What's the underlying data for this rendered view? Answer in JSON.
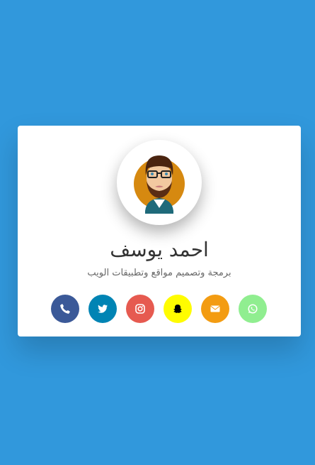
{
  "profile": {
    "name": "احمد يوسف",
    "title": "برمجة وتصميم مواقع وتطبيقات الويب"
  },
  "socials": [
    {
      "name": "phone",
      "color": "#3b5998"
    },
    {
      "name": "twitter",
      "color": "#0084b4"
    },
    {
      "name": "instagram",
      "color": "#e65a50"
    },
    {
      "name": "snapchat",
      "color": "#fffc00"
    },
    {
      "name": "email",
      "color": "#f39c12"
    },
    {
      "name": "whatsapp",
      "color": "#90ee90"
    }
  ]
}
